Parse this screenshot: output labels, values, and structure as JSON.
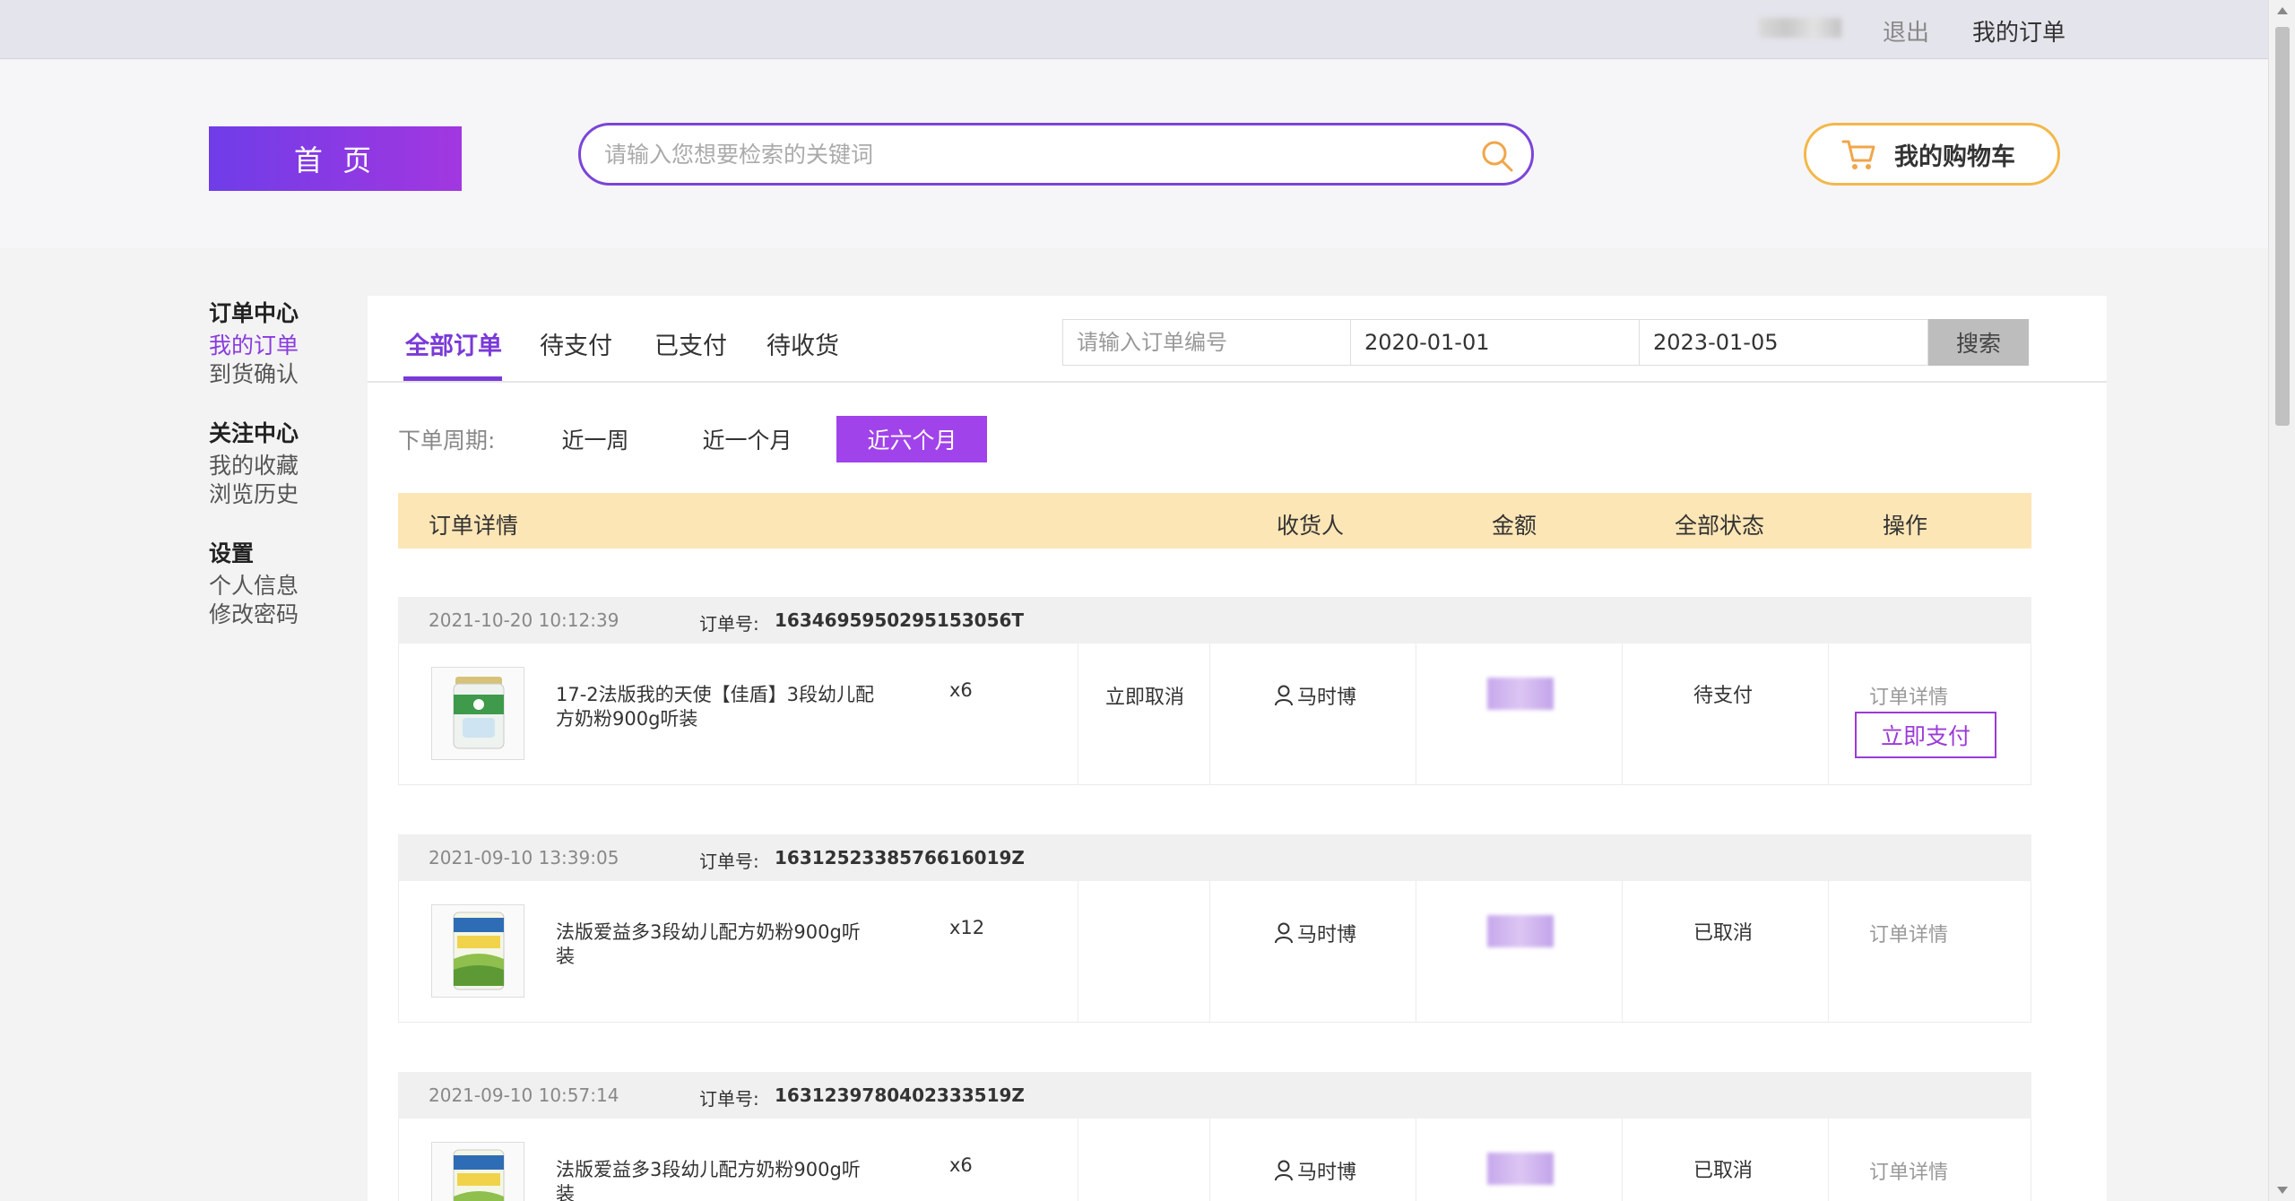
{
  "topbar": {
    "logout": "退出",
    "my_orders": "我的订单"
  },
  "header": {
    "home_label": "首 页",
    "search_placeholder": "请输入您想要检索的关键词",
    "cart_label": "我的购物车"
  },
  "sidebar": {
    "sections": [
      {
        "title": "订单中心",
        "items": [
          "我的订单",
          "到货确认"
        ]
      },
      {
        "title": "关注中心",
        "items": [
          "我的收藏",
          "浏览历史"
        ]
      },
      {
        "title": "设置",
        "items": [
          "个人信息",
          "修改密码"
        ]
      }
    ]
  },
  "tabs": [
    "全部订单",
    "待支付",
    "已支付",
    "待收货"
  ],
  "order_search": {
    "placeholder": "请输入订单编号",
    "start_date": "2020-01-01",
    "end_date": "2023-01-05",
    "button": "搜索"
  },
  "period": {
    "label": "下单周期:",
    "options": [
      "近一周",
      "近一个月",
      "近六个月"
    ],
    "selected": "近六个月"
  },
  "table_header": [
    "订单详情",
    "收货人",
    "金额",
    "全部状态",
    "操作"
  ],
  "order_no_label": "订单号:",
  "orders": [
    {
      "date": "2021-10-20 10:12:39",
      "order_no": "1634695950295153056T",
      "product": "17-2法版我的天使【佳盾】3段幼儿配方奶粉900g听装",
      "qty": "x6",
      "cancel": "立即取消",
      "receiver": "马时博",
      "status": "待支付",
      "detail": "订单详情",
      "pay": "立即支付"
    },
    {
      "date": "2021-09-10 13:39:05",
      "order_no": "1631252338576616019Z",
      "product": "法版爱益多3段幼儿配方奶粉900g听装",
      "qty": "x12",
      "receiver": "马时博",
      "status": "已取消",
      "detail": "订单详情"
    },
    {
      "date": "2021-09-10 10:57:14",
      "order_no": "1631239780402333519Z",
      "product": "法版爱益多3段幼儿配方奶粉900g听装",
      "qty": "x6",
      "receiver": "马时博",
      "status": "已取消",
      "detail": "订单详情"
    }
  ],
  "colors": {
    "accent": "#7a3ad8",
    "cart_border": "#f3b84a",
    "table_header": "#fde6b6"
  }
}
